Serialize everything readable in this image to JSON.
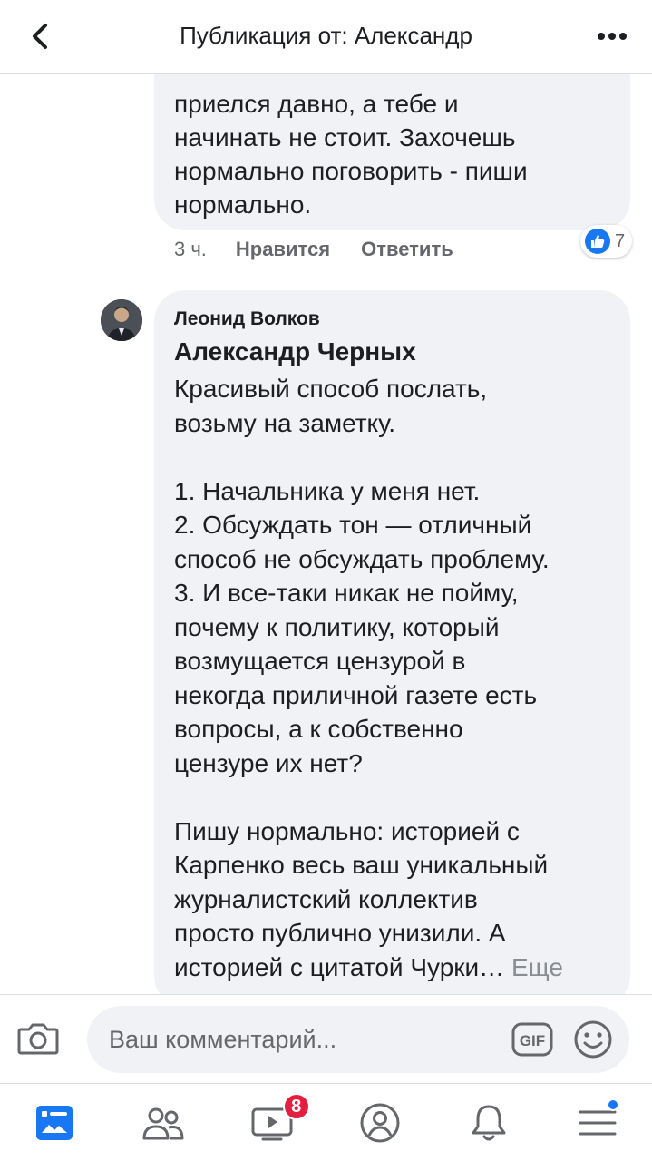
{
  "header": {
    "title": "Публикация от: Александр",
    "back_icon": "chevron-left-icon",
    "more_icon": "more-dots-icon"
  },
  "comment_prev": {
    "text_lines": "приелся давно, а тебе и\nначинать не стоит. Захочешь\nнормально поговорить - пиши\nнормально.",
    "time": "3 ч.",
    "like_label": "Нравится",
    "reply_label": "Ответить",
    "reaction_count": "7",
    "reaction_icon": "like-icon"
  },
  "comment_main": {
    "author": "Леонид Волков",
    "mention": "Александр Черных",
    "body": "Красивый способ послать,\nвозьму на заметку.\n\n1. Начальника у меня нет.\n2. Обсуждать тон — отличный\nспособ не обсуждать проблему.\n3. И все-таки никак не пойму,\nпочему к политику, который\nвозмущается цензурой в\nнекогда приличной газете есть\nвопросы, а к собственно\nцензуре их нет?\n\nПишу нормально: историей с\nКарпенко весь ваш уникальный\nжурналистский коллектив\nпросто публично унизили. А\nисторией с цитатой Чурки… ",
    "more_label": "Еще"
  },
  "composer": {
    "placeholder": "Ваш комментарий...",
    "gif_label": "GIF"
  },
  "tabbar": {
    "video_badge": "8",
    "items": [
      "news-feed-icon",
      "friends-icon",
      "watch-video-icon",
      "profile-icon",
      "notifications-bell-icon",
      "menu-icon"
    ]
  },
  "colors": {
    "accent": "#1877f2",
    "bubble": "#f0f2f5",
    "badge": "#e41e3f",
    "secondary_text": "#65676b"
  }
}
